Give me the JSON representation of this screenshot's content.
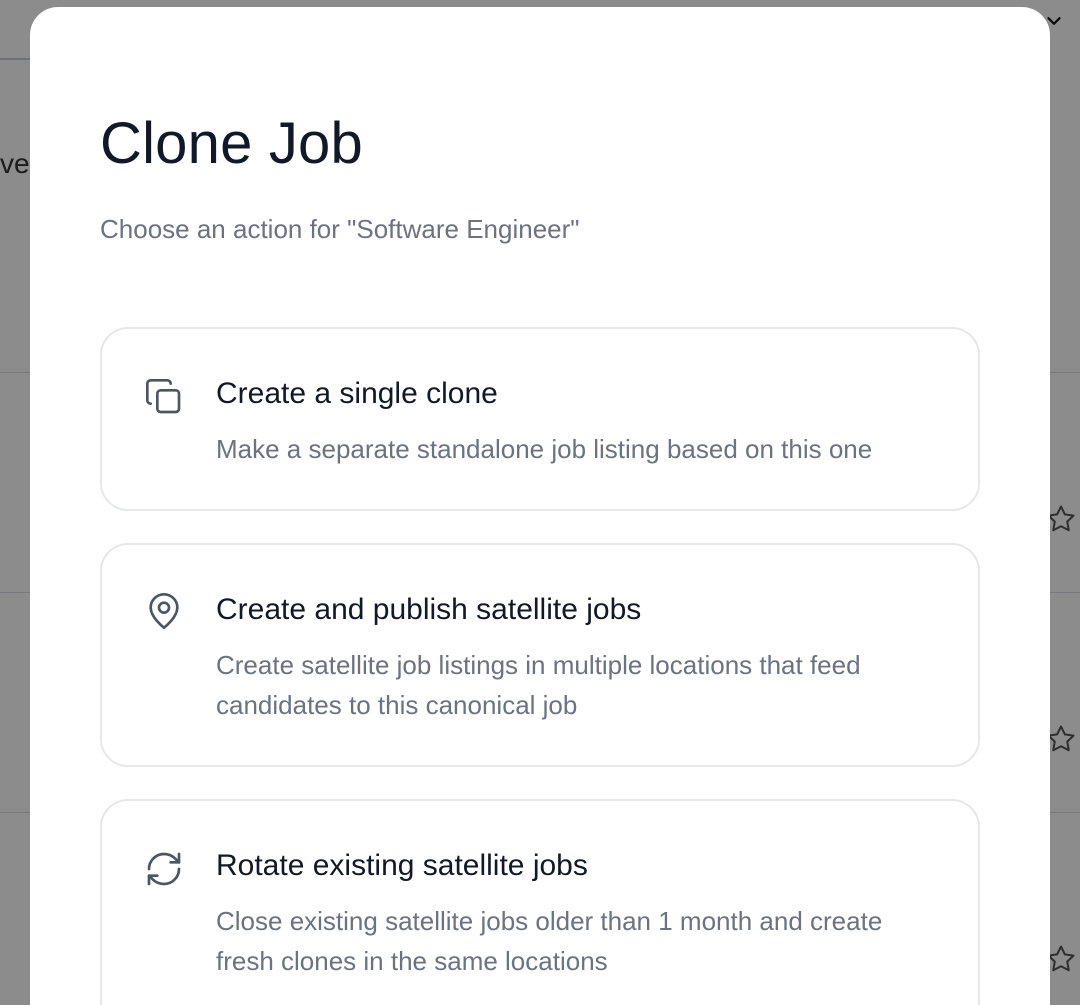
{
  "background": {
    "partial_text": "ve"
  },
  "modal": {
    "title": "Clone Job",
    "subtitle": "Choose an action for \"Software Engineer\"",
    "options": [
      {
        "icon": "copy-icon",
        "title": "Create a single clone",
        "description": "Make a separate standalone job listing based on this one"
      },
      {
        "icon": "map-pin-icon",
        "title": "Create and publish satellite jobs",
        "description": "Create satellite job listings in multiple locations that feed candidates to this canonical job"
      },
      {
        "icon": "refresh-icon",
        "title": "Rotate existing satellite jobs",
        "description": "Close existing satellite jobs older than 1 month and create fresh clones in the same locations"
      }
    ]
  },
  "colors": {
    "title": "#111827",
    "muted": "#6b7280",
    "border": "#e5e7eb",
    "overlay": "rgba(0,0,0,0.45)"
  }
}
